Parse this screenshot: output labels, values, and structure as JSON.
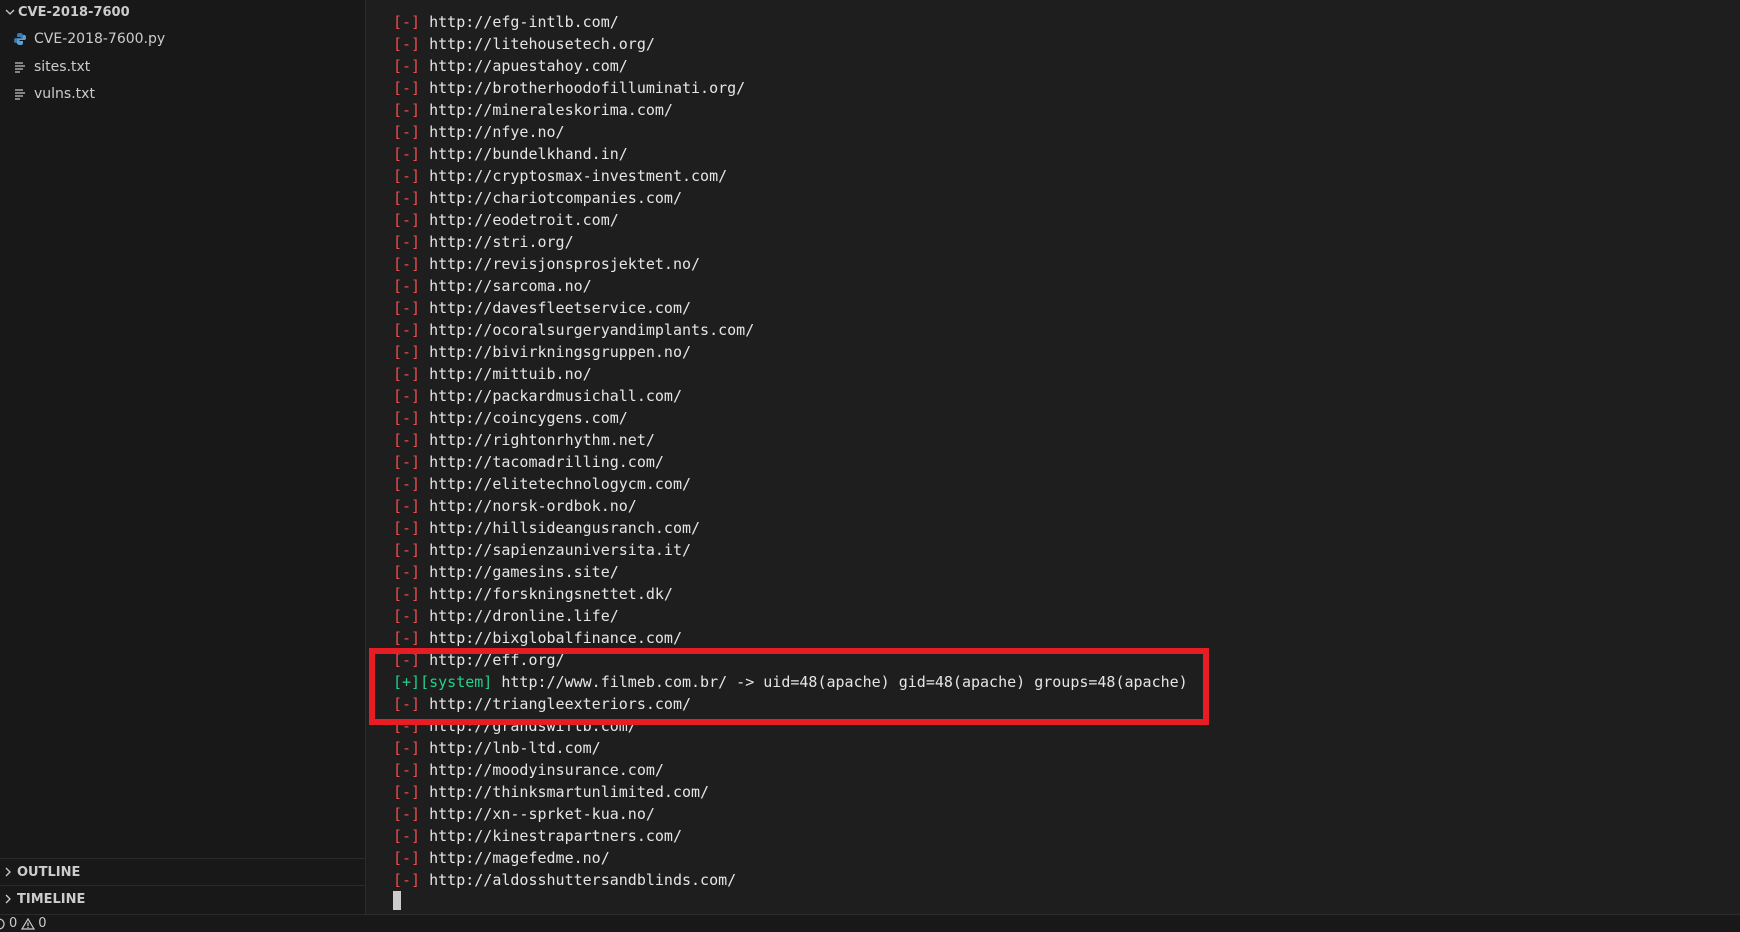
{
  "explorer": {
    "folder_name": "CVE-2018-7600",
    "files": [
      {
        "name": "CVE-2018-7600.py",
        "icon": "python-file-icon"
      },
      {
        "name": "sites.txt",
        "icon": "text-file-icon"
      },
      {
        "name": "vulns.txt",
        "icon": "text-file-icon"
      }
    ],
    "panels": {
      "outline": "OUTLINE",
      "timeline": "TIMELINE"
    }
  },
  "statusbar": {
    "errors": "0",
    "warnings": "0"
  },
  "terminal": {
    "fail_tag": "[-]",
    "ok_tag": "[+][system]",
    "lines": [
      {
        "tag": "[-]",
        "text": "http://efg-intlb.com/"
      },
      {
        "tag": "[-]",
        "text": "http://litehousetech.org/"
      },
      {
        "tag": "[-]",
        "text": "http://apuestahoy.com/"
      },
      {
        "tag": "[-]",
        "text": "http://brotherhoodofilluminati.org/"
      },
      {
        "tag": "[-]",
        "text": "http://mineraleskorima.com/"
      },
      {
        "tag": "[-]",
        "text": "http://nfye.no/"
      },
      {
        "tag": "[-]",
        "text": "http://bundelkhand.in/"
      },
      {
        "tag": "[-]",
        "text": "http://cryptosmax-investment.com/"
      },
      {
        "tag": "[-]",
        "text": "http://chariotcompanies.com/"
      },
      {
        "tag": "[-]",
        "text": "http://eodetroit.com/"
      },
      {
        "tag": "[-]",
        "text": "http://stri.org/"
      },
      {
        "tag": "[-]",
        "text": "http://revisjonsprosjektet.no/"
      },
      {
        "tag": "[-]",
        "text": "http://sarcoma.no/"
      },
      {
        "tag": "[-]",
        "text": "http://davesfleetservice.com/"
      },
      {
        "tag": "[-]",
        "text": "http://ocoralsurgeryandimplants.com/"
      },
      {
        "tag": "[-]",
        "text": "http://bivirkningsgruppen.no/"
      },
      {
        "tag": "[-]",
        "text": "http://mittuib.no/"
      },
      {
        "tag": "[-]",
        "text": "http://packardmusichall.com/"
      },
      {
        "tag": "[-]",
        "text": "http://coincygens.com/"
      },
      {
        "tag": "[-]",
        "text": "http://rightonrhythm.net/"
      },
      {
        "tag": "[-]",
        "text": "http://tacomadrilling.com/"
      },
      {
        "tag": "[-]",
        "text": "http://elitetechnologycm.com/"
      },
      {
        "tag": "[-]",
        "text": "http://norsk-ordbok.no/"
      },
      {
        "tag": "[-]",
        "text": "http://hillsideangusranch.com/"
      },
      {
        "tag": "[-]",
        "text": "http://sapienzauniversita.it/"
      },
      {
        "tag": "[-]",
        "text": "http://gamesins.site/"
      },
      {
        "tag": "[-]",
        "text": "http://forskningsnettet.dk/"
      },
      {
        "tag": "[-]",
        "text": "http://dronline.life/"
      },
      {
        "tag": "[-]",
        "text": "http://bixglobalfinance.com/"
      },
      {
        "tag": "[-]",
        "text": "http://eff.org/"
      },
      {
        "tag": "[+][system]",
        "text": "http://www.filmeb.com.br/ -> uid=48(apache) gid=48(apache) groups=48(apache)"
      },
      {
        "tag": "[-]",
        "text": "http://triangleexteriors.com/"
      },
      {
        "tag": "[-]",
        "text": "http://grandswiftb.com/"
      },
      {
        "tag": "[-]",
        "text": "http://lnb-ltd.com/"
      },
      {
        "tag": "[-]",
        "text": "http://moodyinsurance.com/"
      },
      {
        "tag": "[-]",
        "text": "http://thinksmartunlimited.com/"
      },
      {
        "tag": "[-]",
        "text": "http://xn--sprket-kua.no/"
      },
      {
        "tag": "[-]",
        "text": "http://kinestrapartners.com/"
      },
      {
        "tag": "[-]",
        "text": "http://magefedme.no/"
      },
      {
        "tag": "[-]",
        "text": "http://aldosshuttersandblinds.com/"
      }
    ]
  },
  "colors": {
    "fail": "#f14c4c",
    "success": "#23d18b",
    "highlight": "#e81c24"
  }
}
